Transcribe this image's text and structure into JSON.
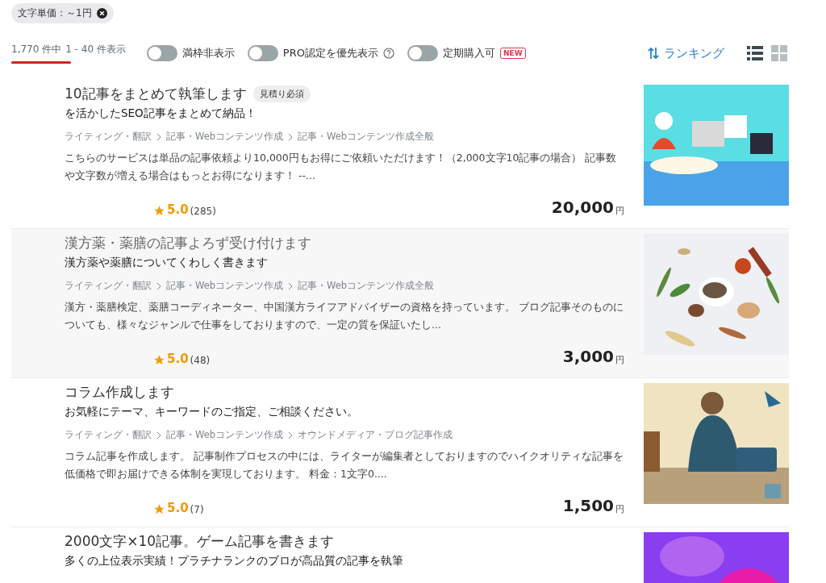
{
  "filter_chip": {
    "label": "文字単価：～1円"
  },
  "result_count": {
    "total": "1,770 件中",
    "range": "1 - 40 件表示"
  },
  "toggles": [
    {
      "kind": "plain",
      "label": "満枠非表示",
      "on": false
    },
    {
      "kind": "help",
      "label": "PRO認定を優先表示",
      "on": false
    },
    {
      "kind": "badge",
      "label": "定期購入可",
      "on": false,
      "badge": "NEW"
    }
  ],
  "sort": {
    "label": "ランキング"
  },
  "view_modes": [
    {
      "kind": "list",
      "selected": true
    },
    {
      "kind": "grid",
      "selected": false
    }
  ],
  "services": [
    {
      "title": "10記事をまとめて執筆します",
      "badge": "見積り必須",
      "subtitle": "を活かしたSEO記事をまとめて納品！",
      "breadcrumbs": [
        "ライティング・翻訳",
        "記事・Webコンテンツ作成",
        "記事・Webコンテンツ作成全般"
      ],
      "description": "こちらのサービスは単品の記事依頼より10,000円もお得にご依頼いただけます！（2,000文字10記事の場合） 記事数や文字数が増える場合はもっとお得になります！ --...",
      "rating": "5.0",
      "reviews": "(285)",
      "price": "20,000",
      "currency": "円",
      "highlighted": false
    },
    {
      "title": "漢方薬・薬膳の記事よろず受け付けます",
      "subtitle": "漢方薬や薬膳についてくわしく書きます",
      "breadcrumbs": [
        "ライティング・翻訳",
        "記事・Webコンテンツ作成",
        "記事・Webコンテンツ作成全般"
      ],
      "description": "漢方・薬膳検定、薬膳コーディネーター、中国漢方ライフアドバイザーの資格を持っています。 ブログ記事そのものについても、様々なジャンルで仕事をしておりますので、一定の質を保証いたし...",
      "rating": "5.0",
      "reviews": "(48)",
      "price": "3,000",
      "currency": "円",
      "highlighted": true
    },
    {
      "title": "コラム作成します",
      "subtitle": "お気軽にテーマ、キーワードのご指定、ご相談ください。",
      "breadcrumbs": [
        "ライティング・翻訳",
        "記事・Webコンテンツ作成",
        "オウンドメディア・ブログ記事作成"
      ],
      "description": "コラム記事を作成します。 記事制作プロセスの中には、ライターが編集者としておりますのでハイクオリティな記事を低価格で即お届けできる体制を実現しております。 料金：1文字0....",
      "rating": "5.0",
      "reviews": "(7)",
      "price": "1,500",
      "currency": "円",
      "highlighted": false
    },
    {
      "title": "2000文字×10記事。ゲーム記事を書きます",
      "subtitle": "多くの上位表示実績！プラチナランクのブロが高品質の記事を執筆",
      "highlighted": false
    }
  ]
}
